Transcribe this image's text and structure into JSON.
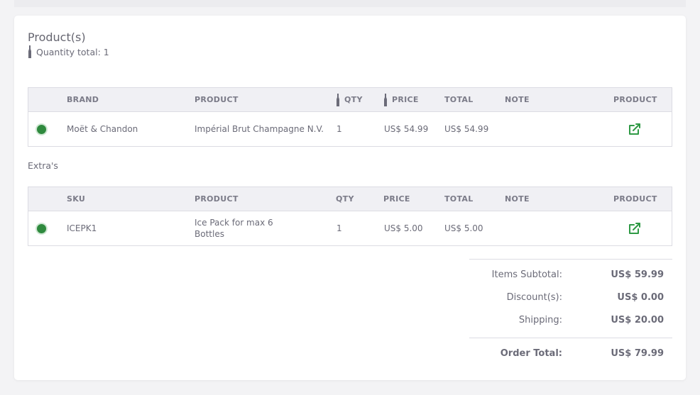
{
  "products": {
    "title": "Product(s)",
    "quantity_total": "Quantity total: 1",
    "columns": {
      "brand": "BRAND",
      "product": "PRODUCT",
      "qty": "QTY",
      "price": "PRICE",
      "total": "TOTAL",
      "note": "NOTE",
      "link": "PRODUCT"
    },
    "rows": [
      {
        "brand": "Moët & Chandon",
        "product": "Impérial Brut Champagne N.V.",
        "qty": "1",
        "price": "US$ 54.99",
        "total": "US$ 54.99",
        "note": "",
        "link_icon": "external-link-icon"
      }
    ]
  },
  "extras": {
    "label": "Extra's",
    "columns": {
      "sku": "SKU",
      "product": "PRODUCT",
      "qty": "QTY",
      "price": "PRICE",
      "total": "TOTAL",
      "note": "NOTE",
      "link": "PRODUCT"
    },
    "rows": [
      {
        "sku": "ICEPK1",
        "product_line1": "Ice Pack for max 6",
        "product_line2": "Bottles",
        "qty": "1",
        "price": "US$ 5.00",
        "total": "US$ 5.00",
        "note": "",
        "link_icon": "external-link-icon"
      }
    ]
  },
  "summary": {
    "items_subtotal_label": "Items Subtotal:",
    "items_subtotal": "US$ 59.99",
    "discount_label": "Discount(s):",
    "discount": "US$ 0.00",
    "shipping_label": "Shipping:",
    "shipping": "US$ 20.00",
    "order_total_label": "Order Total:",
    "order_total": "US$ 79.99"
  },
  "colors": {
    "status_green": "#2f8a3e",
    "link_green": "#2f9a45",
    "header_bg": "#f0f0f4"
  }
}
